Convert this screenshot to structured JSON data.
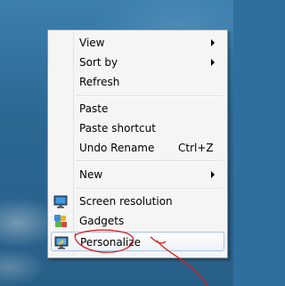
{
  "context_menu": {
    "items": [
      {
        "label": "View",
        "submenu": true
      },
      {
        "label": "Sort by",
        "submenu": true
      },
      {
        "label": "Refresh"
      },
      {
        "label": "Paste"
      },
      {
        "label": "Paste shortcut"
      },
      {
        "label": "Undo Rename",
        "shortcut": "Ctrl+Z"
      },
      {
        "label": "New",
        "submenu": true
      },
      {
        "label": "Screen resolution",
        "icon": "screen-resolution-icon"
      },
      {
        "label": "Gadgets",
        "icon": "gadgets-icon"
      },
      {
        "label": "Personalize",
        "icon": "personalize-icon",
        "highlighted": true
      }
    ]
  },
  "annotation": {
    "color": "#d81c1c"
  }
}
